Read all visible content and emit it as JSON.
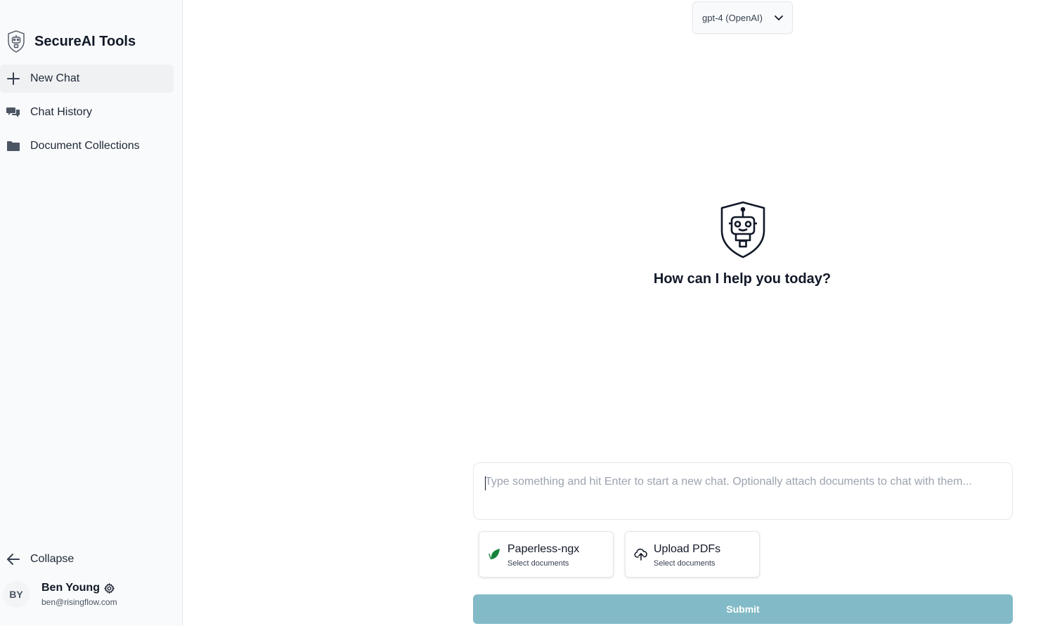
{
  "app": {
    "title": "SecureAI Tools"
  },
  "sidebar": {
    "items": [
      {
        "label": "New Chat",
        "icon": "plus-icon"
      },
      {
        "label": "Chat History",
        "icon": "chat-bubbles-icon"
      },
      {
        "label": "Document Collections",
        "icon": "folder-icon"
      }
    ],
    "collapse_label": "Collapse"
  },
  "user": {
    "initials": "BY",
    "name": "Ben Young",
    "email": "ben@risingflow.com"
  },
  "model_selector": {
    "value": "gpt-4 (OpenAI)"
  },
  "hero": {
    "text": "How can I help you today?"
  },
  "chat_input": {
    "placeholder": "Type something and hit Enter to start a new chat. Optionally attach documents to chat with them..."
  },
  "sources": [
    {
      "title": "Paperless-ngx",
      "subtitle": "Select documents",
      "icon": "leaf-icon"
    },
    {
      "title": "Upload PDFs",
      "subtitle": "Select documents",
      "icon": "cloud-upload-icon"
    }
  ],
  "submit_label": "Submit",
  "colors": {
    "submit": "#82bac7",
    "sidebar_bg": "#f9fafb",
    "leaf": "#17823c"
  }
}
